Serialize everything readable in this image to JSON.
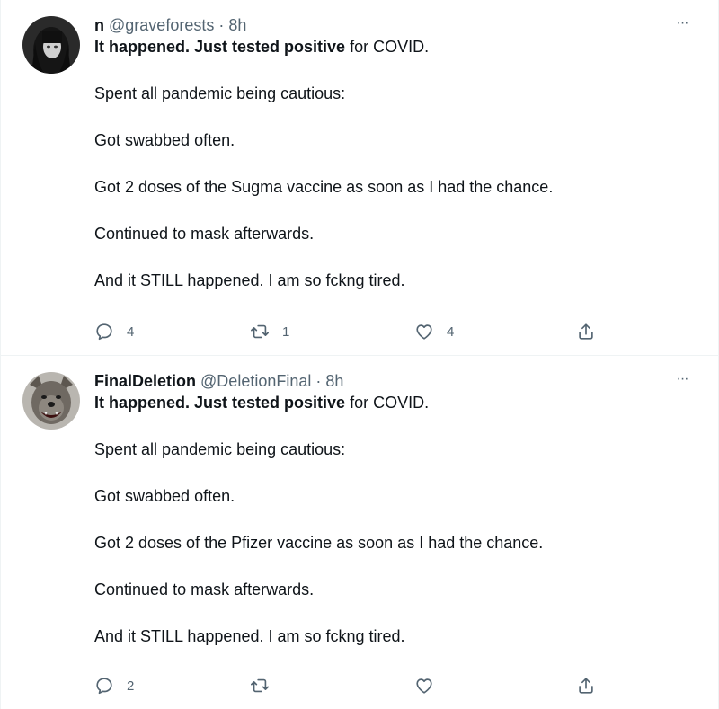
{
  "tweets": [
    {
      "display_name": "n",
      "handle": "@graveforests",
      "separator": "·",
      "time": "8h",
      "paragraphs": [
        {
          "bold": "It happened. Just tested positive",
          "rest": " for COVID."
        },
        {
          "bold": "",
          "rest": "Spent all pandemic being cautious:"
        },
        {
          "bold": "",
          "rest": "Got swabbed often."
        },
        {
          "bold": "",
          "rest": "Got 2 doses of the Sugma vaccine as soon as I had the chance."
        },
        {
          "bold": "",
          "rest": "Continued to mask afterwards."
        },
        {
          "bold": "",
          "rest": "And it STILL happened. I am so fckng tired."
        }
      ],
      "more_icon": "···",
      "replies": "4",
      "retweets": "1",
      "likes": "4",
      "avatar_icon": "dark-hair-portrait"
    },
    {
      "display_name": "FinalDeletion",
      "handle": "@DeletionFinal",
      "separator": "·",
      "time": "8h",
      "paragraphs": [
        {
          "bold": "It happened. Just tested positive",
          "rest": " for COVID."
        },
        {
          "bold": "",
          "rest": "Spent all pandemic being cautious:"
        },
        {
          "bold": "",
          "rest": "Got swabbed often."
        },
        {
          "bold": "",
          "rest": "Got 2 doses of the Pfizer vaccine as soon as I had the chance."
        },
        {
          "bold": "",
          "rest": "Continued to mask afterwards."
        },
        {
          "bold": "",
          "rest": "And it STILL happened. I am so fckng tired."
        }
      ],
      "more_icon": "···",
      "replies": "2",
      "retweets": "",
      "likes": "",
      "avatar_icon": "wolf-portrait"
    }
  ],
  "colors": {
    "text": "#0f1419",
    "secondary": "#536471",
    "border": "#eff3f4"
  }
}
